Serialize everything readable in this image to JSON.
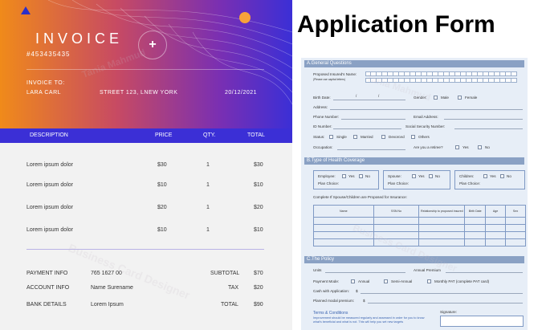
{
  "invoice": {
    "title": "INVOICE",
    "number": "#453435435",
    "plus_symbol": "+",
    "to_label": "INVOICE TO:",
    "to_name": "LARA CARL",
    "to_address": "STREET 123, LNEW YORK",
    "date": "20/12/2021",
    "columns": [
      "DESCRIPTION",
      "PRICE",
      "QTY.",
      "TOTAL"
    ],
    "items": [
      {
        "desc": "Lorem ipsum dolor",
        "price": "$30",
        "qty": "1",
        "total": "$30"
      },
      {
        "desc": "Lorem ipsum dolor",
        "price": "$10",
        "qty": "1",
        "total": "$10"
      },
      {
        "desc": "Lorem ipsum dolor",
        "price": "$20",
        "qty": "1",
        "total": "$20"
      },
      {
        "desc": "Lorem ipsum dolor",
        "price": "$10",
        "qty": "1",
        "total": "$10"
      }
    ],
    "footer": [
      {
        "label": "PAYMENT INFO",
        "value": "765 1627 00",
        "sum_label": "SUBTOTAL",
        "sum": "$70"
      },
      {
        "label": "ACCOUNT INFO",
        "value": "Name Surename",
        "sum_label": "TAX",
        "sum": "$20"
      },
      {
        "label": "BANK DETAILS",
        "value": "Lorem Ipsum",
        "sum_label": "TOTAL",
        "sum": "$90"
      }
    ],
    "colors": {
      "accent": "#3b2fd6",
      "orange": "#f08a1a"
    }
  },
  "form": {
    "title": "Application Form",
    "sections": {
      "general": "A.General Questions",
      "coverage": "B.Type of Health Coverage",
      "policy": "C.The Policy"
    },
    "general": {
      "insured_name": "Proposed Insured's Name:",
      "insured_name_note": "(Please use capital letters)",
      "birth_date": "Birth Date:",
      "date_sep": "/",
      "gender": "Gender:",
      "male": "Male",
      "female": "Female",
      "address": "Address:",
      "phone": "Phone Number:",
      "email": "Email Address:",
      "id": "ID Number:",
      "ssn": "Social Security Number:",
      "status": "Status:",
      "single": "Single",
      "married": "Married",
      "divorced": "Devorced",
      "others": "Others",
      "occupation": "Occupation:",
      "retiree": "Are you a retiree?",
      "yes": "Yes",
      "no": "No"
    },
    "coverage": {
      "employee": "Employee:",
      "spouse": "Spouse:",
      "children": "Children:",
      "yes": "Yes",
      "no": "No",
      "plan_choice": "Plan Choice:",
      "note": "Complete If Spouse/Children are Proposed for Insurance:",
      "table_headers": [
        "Name",
        "SSN No",
        "Relationship to proposed insured",
        "Birth Date",
        "Age",
        "Sex"
      ]
    },
    "policy": {
      "units": "Units",
      "annual_premium": "Annual Premium",
      "payment_mode": "Payment Mode:",
      "annual": "Annual",
      "semi_annual": "Semi-Annual",
      "monthly": "Monthly PAT (complete PAT card)",
      "cash": "Cash with Application:",
      "currency": "$",
      "modal": "Planned modal premium:",
      "terms_title": "Terms & Conditions",
      "terms_text": "Improvement should be measured regularly and assessed in order for you to know what's beneficial and what is not. This will help you set new targets",
      "signature": "Signature:"
    },
    "colors": {
      "section": "#8aa1c4",
      "background": "#e7eef7",
      "border": "#7f99c4"
    }
  },
  "watermark": {
    "name": "Tania Mahmud",
    "line2": "Business Card Designer"
  }
}
